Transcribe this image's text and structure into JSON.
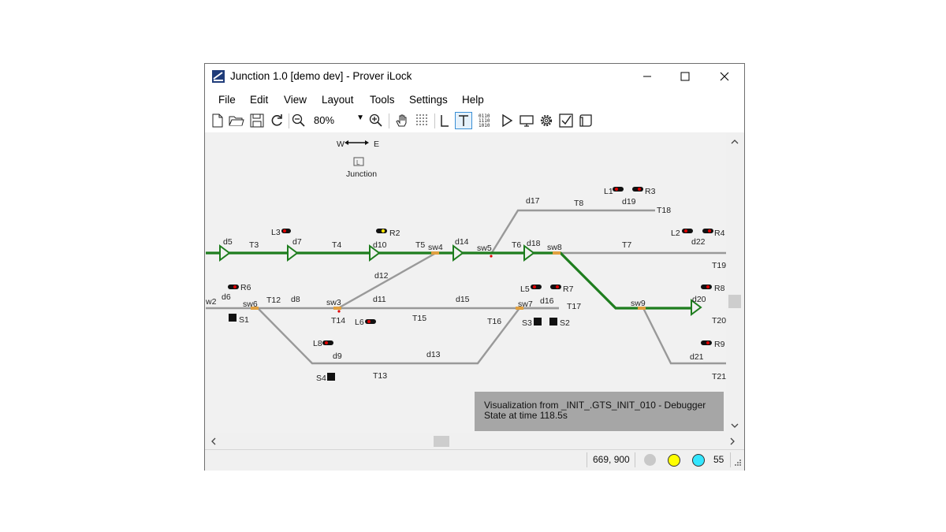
{
  "window": {
    "title": "Junction 1.0 [demo dev] - Prover iLock"
  },
  "menu": [
    "File",
    "Edit",
    "View",
    "Layout",
    "Tools",
    "Settings",
    "Help"
  ],
  "toolbar": {
    "zoom_value": "80%",
    "icons": [
      "new-file-icon",
      "open-folder-icon",
      "save-icon",
      "refresh-icon",
      "zoom-out-icon",
      "zoom-in-icon",
      "hand-pan-icon",
      "grid-icon",
      "L-mode-icon",
      "T-mode-icon",
      "binary-icon",
      "play-icon",
      "monitor-icon",
      "settings-gear-icon",
      "checklist-icon",
      "document-icon"
    ]
  },
  "canvas": {
    "compass": {
      "west": "W",
      "east": "E"
    },
    "junction_label": "Junction",
    "junction_badge": "L",
    "labels": {
      "d5": "d5",
      "T3": "T3",
      "L3": "L3",
      "d7": "d7",
      "T4": "T4",
      "R2": "R2",
      "d10": "d10",
      "T5": "T5",
      "sw4": "sw4",
      "d14": "d14",
      "sw5": "sw5",
      "T6": "T6",
      "d18": "d18",
      "sw8": "sw8",
      "T7": "T7",
      "d17": "d17",
      "T8": "T8",
      "d19": "d19",
      "T18": "T18",
      "L1": "L1",
      "R3": "R3",
      "L2": "L2",
      "R4": "R4",
      "d22": "d22",
      "T19": "T19",
      "R6": "R6",
      "d6": "d6",
      "w2": "w2",
      "sw6": "sw6",
      "T12": "T12",
      "d8": "d8",
      "sw3": "sw3",
      "S1": "S1",
      "d12": "d12",
      "d11": "d11",
      "T14": "T14",
      "L6": "L6",
      "T15": "T15",
      "d15": "d15",
      "T16": "T16",
      "L5": "L5",
      "R7": "R7",
      "sw7": "sw7",
      "d16": "d16",
      "T17": "T17",
      "S3": "S3",
      "S2": "S2",
      "sw9": "sw9",
      "R8": "R8",
      "d20": "d20",
      "T20": "T20",
      "L8": "L8",
      "d9": "d9",
      "d13": "d13",
      "S4": "S4",
      "T13": "T13",
      "R9": "R9",
      "d21": "d21",
      "T21": "T21"
    },
    "info": {
      "line1": "Visualization from _INIT_.GTS_INIT_010 - Debugger",
      "line2": "State at time 118.5s"
    }
  },
  "statusbar": {
    "coords": "669, 900",
    "count": "55",
    "indicator_colors": [
      "#c8c8c8",
      "#ffff00",
      "#33e6ff"
    ]
  },
  "colors": {
    "active_track": "#1e7d1e",
    "track": "#999999",
    "signal_red": "#e00000",
    "signal_yellow": "#f0e000"
  }
}
